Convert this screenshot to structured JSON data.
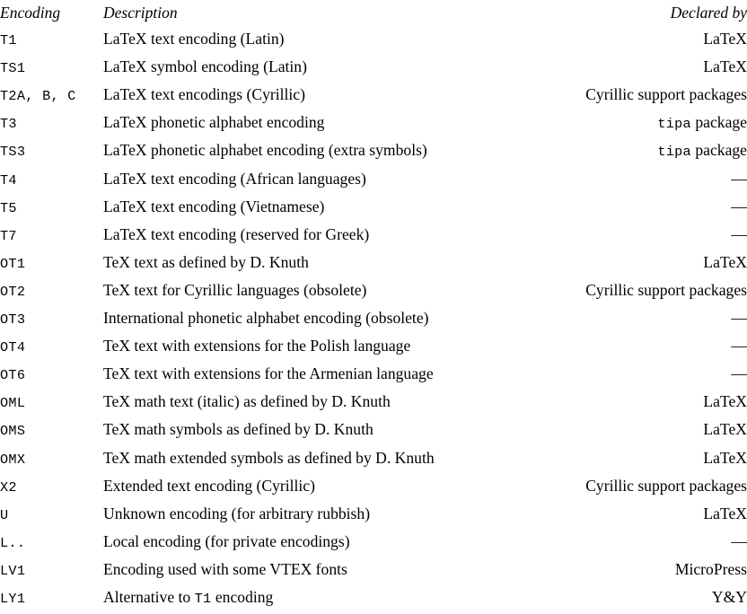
{
  "table": {
    "headers": {
      "encoding": "Encoding",
      "description": "Description",
      "declared_by": "Declared by"
    },
    "em_dash": "—",
    "rows": [
      {
        "encoding": "T1",
        "description": "LaTeX text encoding (Latin)",
        "declared_by": "LaTeX"
      },
      {
        "encoding": "TS1",
        "description": "LaTeX symbol encoding (Latin)",
        "declared_by": "LaTeX"
      },
      {
        "encoding": "T2A, B, C",
        "description": "LaTeX text encodings (Cyrillic)",
        "declared_by": "Cyrillic support packages"
      },
      {
        "encoding": "T3",
        "description": "LaTeX phonetic alphabet encoding",
        "declared_by": "tipa package",
        "declared_tt": "tipa",
        "declared_rm": " package"
      },
      {
        "encoding": "TS3",
        "description": "LaTeX phonetic alphabet encoding (extra symbols)",
        "declared_by": "tipa package",
        "declared_tt": "tipa",
        "declared_rm": " package"
      },
      {
        "encoding": "T4",
        "description": "LaTeX text encoding (African languages)",
        "declared_by": "—"
      },
      {
        "encoding": "T5",
        "description": "LaTeX text encoding (Vietnamese)",
        "declared_by": "—"
      },
      {
        "encoding": "T7",
        "description": "LaTeX text encoding (reserved for Greek)",
        "declared_by": "—"
      },
      {
        "encoding": "OT1",
        "description": "TeX text as defined by D. Knuth",
        "declared_by": "LaTeX"
      },
      {
        "encoding": "OT2",
        "description": "TeX text for Cyrillic languages (obsolete)",
        "declared_by": "Cyrillic support packages"
      },
      {
        "encoding": "OT3",
        "description": "International phonetic alphabet encoding (obsolete)",
        "declared_by": "—"
      },
      {
        "encoding": "OT4",
        "description": "TeX text with extensions for the Polish language",
        "declared_by": "—"
      },
      {
        "encoding": "OT6",
        "description": "TeX text with extensions for the Armenian language",
        "declared_by": "—"
      },
      {
        "encoding": "OML",
        "description": "TeX math text (italic) as defined by D. Knuth",
        "declared_by": "LaTeX"
      },
      {
        "encoding": "OMS",
        "description": "TeX math symbols as defined by D. Knuth",
        "declared_by": "LaTeX"
      },
      {
        "encoding": "OMX",
        "description": "TeX math extended symbols as defined by D. Knuth",
        "declared_by": "LaTeX"
      },
      {
        "encoding": "X2",
        "description": "Extended text encoding (Cyrillic)",
        "declared_by": "Cyrillic support packages"
      },
      {
        "encoding": "U",
        "description": "Unknown encoding (for arbitrary rubbish)",
        "declared_by": "LaTeX"
      },
      {
        "encoding": "L..",
        "description": "Local encoding (for private encodings)",
        "declared_by": "—"
      },
      {
        "encoding": "LV1",
        "description": "Encoding used with some VTEX fonts",
        "declared_by": "MicroPress"
      },
      {
        "encoding": "LY1",
        "description": "Alternative to T1 encoding",
        "declared_by": "Y&Y",
        "desc_pre": "Alternative to ",
        "desc_tt": "T1",
        "desc_post": " encoding"
      }
    ]
  }
}
